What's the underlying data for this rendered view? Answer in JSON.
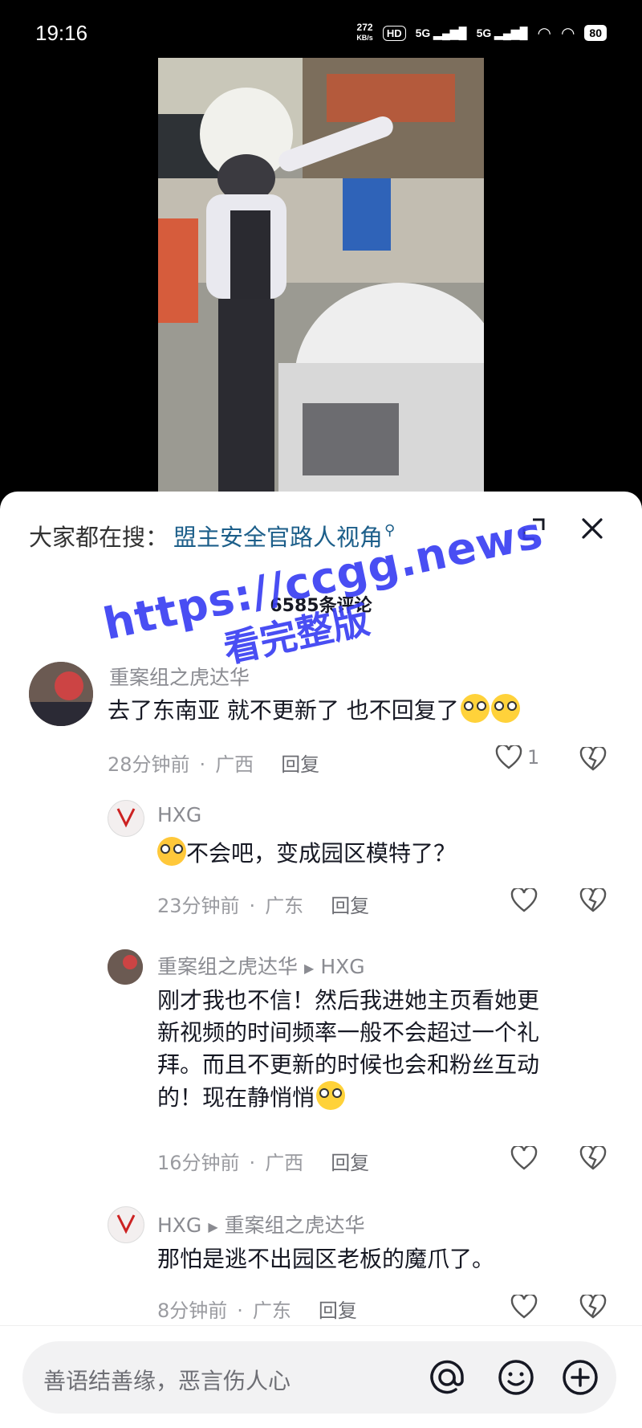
{
  "status_bar": {
    "time": "19:16",
    "net_speed_top": "272",
    "net_speed_unit": "KB/s",
    "hd": "HD",
    "sig1": "5G",
    "sig2": "5G",
    "battery": "80"
  },
  "search": {
    "prefix": "大家都在搜：",
    "term": "盟主安全官路人视角"
  },
  "comment_count": "6585条评论",
  "watermark": {
    "line1": "https://ccgg.news",
    "line2": "看完整版"
  },
  "comments": [
    {
      "author": "重案组之虎达华",
      "text": "去了东南亚 就不更新了 也不回复了",
      "time": "28分钟前",
      "location": "广西",
      "reply_label": "回复",
      "likes": "1"
    },
    {
      "author": "HXG",
      "text": "不会吧，变成园区模特了？",
      "time": "23分钟前",
      "location": "广东",
      "reply_label": "回复"
    },
    {
      "author": "重案组之虎达华",
      "reply_to": "HXG",
      "text_lines": [
        "刚才我也不信！然后我进她主页看她更",
        "新视频的时间频率一般不会超过一个礼",
        "拜。而且不更新的时候也会和粉丝互动",
        "的！现在静悄悄"
      ],
      "time": "16分钟前",
      "location": "广西",
      "reply_label": "回复"
    },
    {
      "author": "HXG",
      "reply_to": "重案组之虎达华",
      "text": "那怕是逃不出园区老板的魔爪了。",
      "time": "8分钟前",
      "location": "广东",
      "reply_label": "回复"
    }
  ],
  "input": {
    "placeholder": "善语结善缘，恶言伤人心"
  },
  "meta_dot": "·"
}
